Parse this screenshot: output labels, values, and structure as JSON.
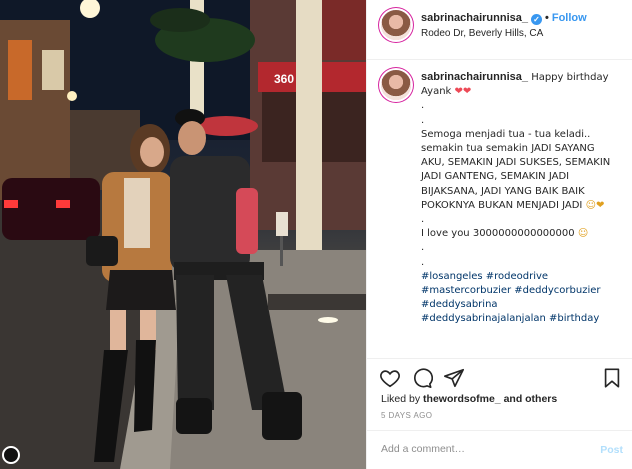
{
  "post": {
    "username": "sabrinachairunnisa_",
    "follow_label": "Follow",
    "location": "Rodeo Dr, Beverly Hills, CA",
    "store_sign": "360"
  },
  "caption": {
    "username": "sabrinachairunnisa_",
    "lines": [
      "Happy birthday Ayank",
      ".",
      ".",
      "Semoga menjadi tua - tua keladi.. semakin tua semakin JADI SAYANG AKU, SEMAKIN JADI SUKSES, SEMAKIN JADI GANTENG, SEMAKIN JADI BIJAKSANA, JADI YANG BAIK BAIK POKOKNYA BUKAN MENJADI JADI",
      ".",
      "I love you 3000000000000000",
      ".",
      "."
    ],
    "hashtags": [
      "#losangeles #rodeodrive",
      "#mastercorbuzier #deddycorbuzier",
      "#deddysabrina",
      "#deddysabrinajalanjalan #birthday"
    ],
    "emoji_hearts": "❤❤",
    "emoji_face_heart": "☺❤",
    "emoji_face": "☺"
  },
  "engagement": {
    "liked_by_prefix": "Liked by",
    "liked_by_user": "thewordsofme_",
    "liked_by_suffix": "and others",
    "time_ago": "5 DAYS AGO"
  },
  "comment": {
    "placeholder": "Add a comment…",
    "post_label": "Post"
  },
  "icons": [
    "heart-icon",
    "comment-icon",
    "share-icon",
    "bookmark-icon",
    "verified-icon",
    "more-icon"
  ],
  "colors": {
    "accent_blue": "#3897f0",
    "post_disabled": "#b2dffc",
    "hashtag": "#003569",
    "heart": "#ed4956",
    "text": "#262626",
    "muted": "#8e8e8e"
  }
}
